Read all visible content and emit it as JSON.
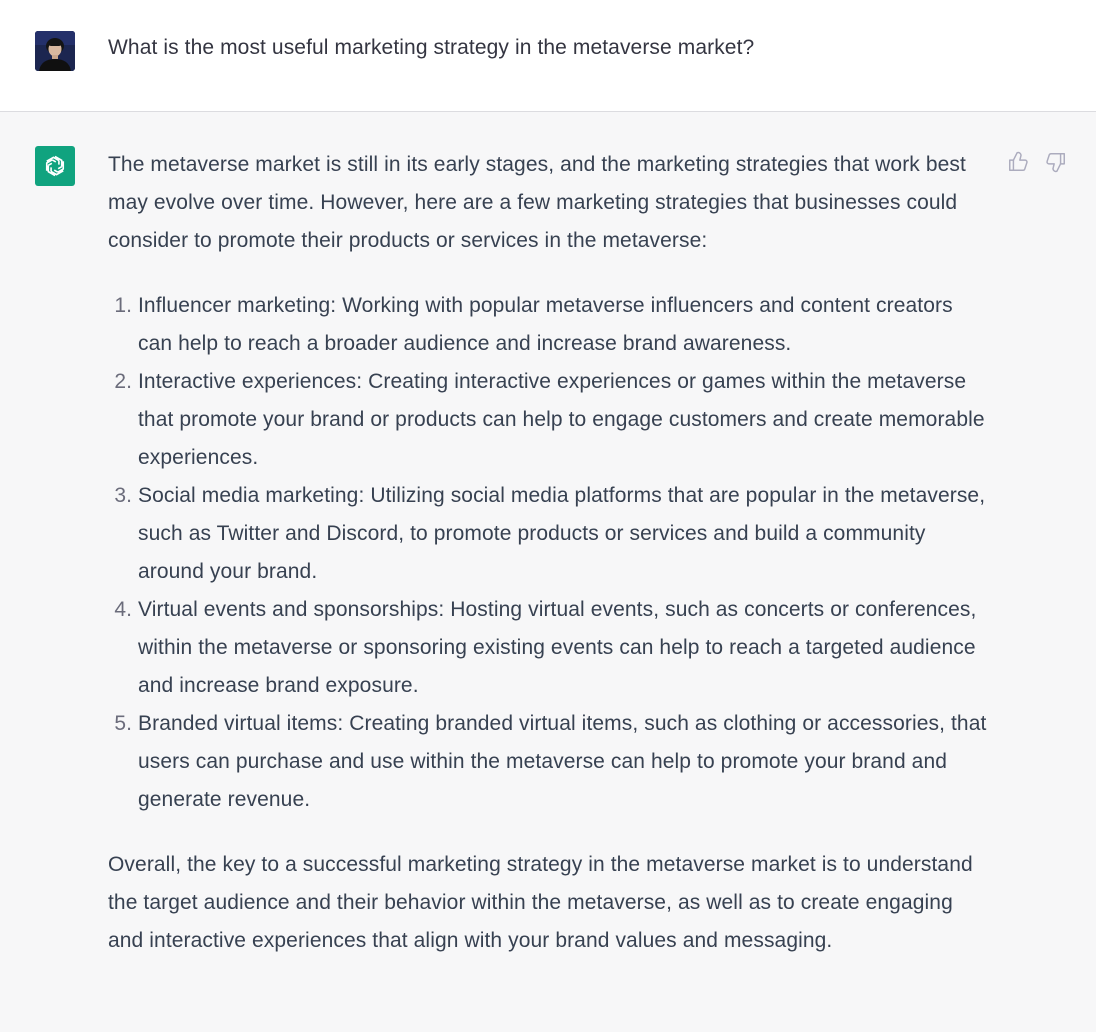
{
  "conversation": {
    "user": {
      "avatar_icon": "user-photo-avatar",
      "message": "What is the most useful marketing strategy in the metaverse market?"
    },
    "assistant": {
      "avatar_icon": "openai-logo-icon",
      "avatar_color": "#10a37f",
      "feedback": {
        "thumbs_up_icon": "thumbs-up-icon",
        "thumbs_down_icon": "thumbs-down-icon"
      },
      "intro": "The metaverse market is still in its early stages, and the marketing strategies that work best may evolve over time. However, here are a few marketing strategies that businesses could consider to promote their products or services in the metaverse:",
      "items": [
        "Influencer marketing: Working with popular metaverse influencers and content creators can help to reach a broader audience and increase brand awareness.",
        "Interactive experiences: Creating interactive experiences or games within the metaverse that promote your brand or products can help to engage customers and create memorable experiences.",
        "Social media marketing: Utilizing social media platforms that are popular in the metaverse, such as Twitter and Discord, to promote products or services and build a community around your brand.",
        "Virtual events and sponsorships: Hosting virtual events, such as concerts or conferences, within the metaverse or sponsoring existing events can help to reach a targeted audience and increase brand exposure.",
        "Branded virtual items: Creating branded virtual items, such as clothing or accessories, that users can purchase and use within the metaverse can help to promote your brand and generate revenue."
      ],
      "conclusion": "Overall, the key to a successful marketing strategy in the metaverse market is to understand the target audience and their behavior within the metaverse, as well as to create engaging and interactive experiences that align with your brand values and messaging."
    }
  }
}
